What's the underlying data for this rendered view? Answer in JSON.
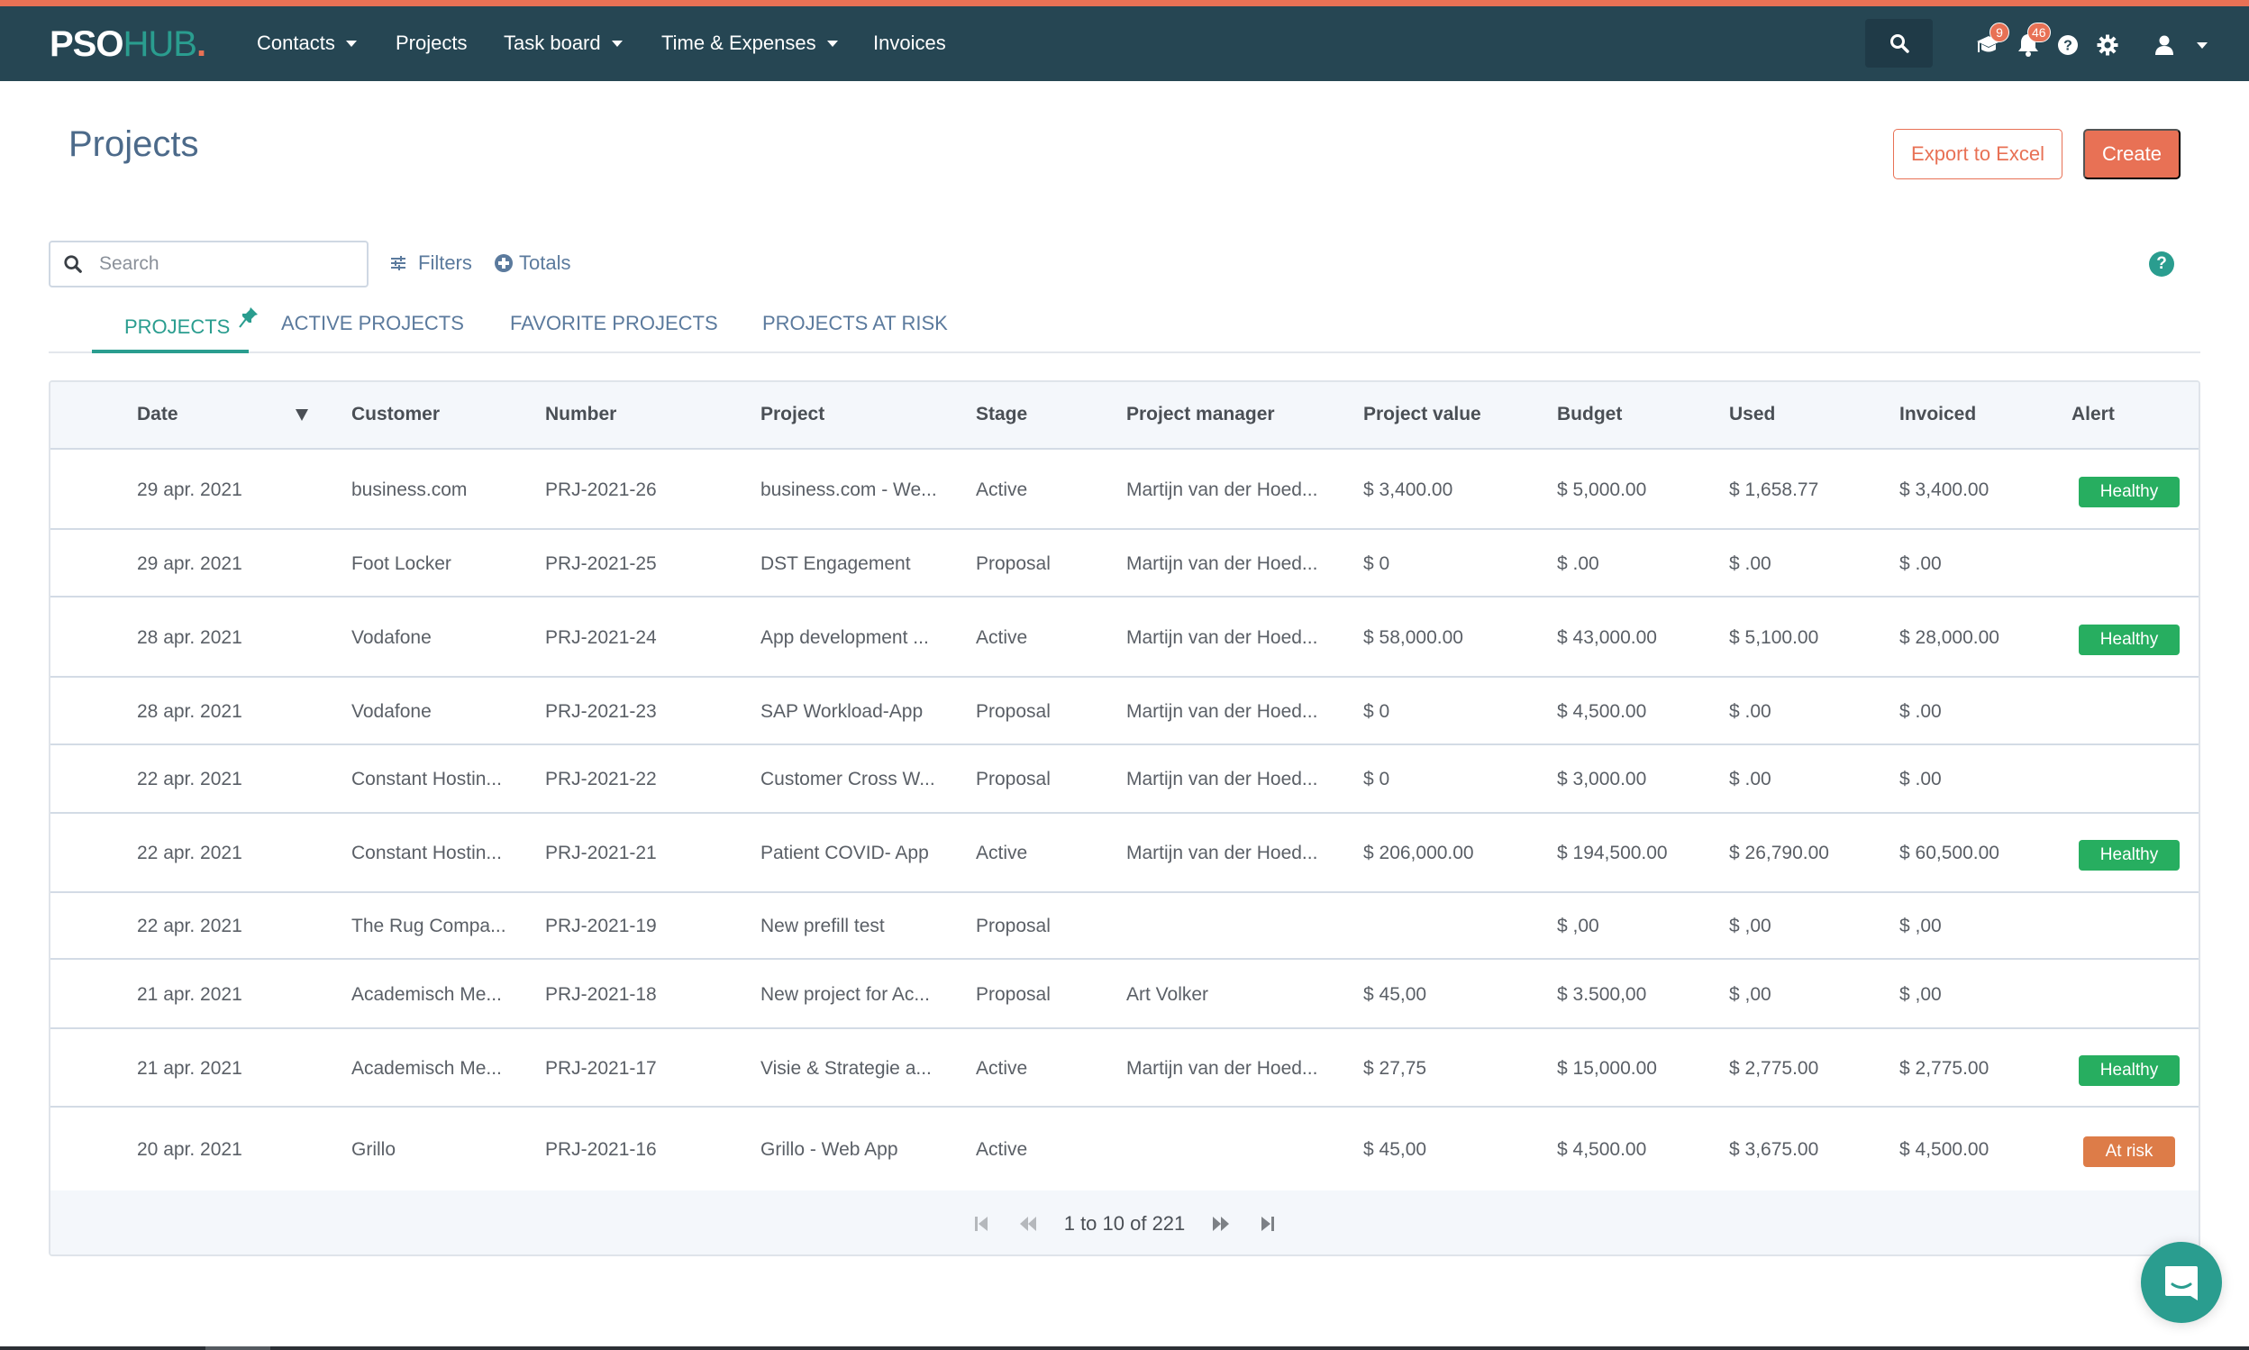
{
  "brand": {
    "part1": "PSO",
    "part2": "HUB",
    "part3": "."
  },
  "nav": {
    "items": [
      {
        "label": "Contacts",
        "dropdown": true
      },
      {
        "label": "Projects",
        "dropdown": false
      },
      {
        "label": "Task board",
        "dropdown": true
      },
      {
        "label": "Time & Expenses",
        "dropdown": true
      },
      {
        "label": "Invoices",
        "dropdown": false
      }
    ],
    "icons": {
      "search": "search-icon",
      "academy": "graduation-cap-icon",
      "notifications": "bell-icon",
      "help": "question-circle-icon",
      "settings": "gear-icon",
      "user": "user-icon"
    },
    "academy_badge": "9",
    "notifications_badge": "46"
  },
  "page": {
    "title": "Projects",
    "export_label": "Export to Excel",
    "create_label": "Create"
  },
  "toolbar": {
    "search_placeholder": "Search",
    "search_value": "",
    "filters_label": "Filters",
    "totals_label": "Totals",
    "help_label": "?"
  },
  "tabs": [
    {
      "label": "PROJECTS",
      "active": true,
      "pinned": true
    },
    {
      "label": "ACTIVE PROJECTS",
      "active": false
    },
    {
      "label": "FAVORITE PROJECTS",
      "active": false
    },
    {
      "label": "PROJECTS AT RISK",
      "active": false
    }
  ],
  "table": {
    "columns": [
      "Date",
      "Customer",
      "Number",
      "Project",
      "Stage",
      "Project manager",
      "Project value",
      "Budget",
      "Used",
      "Invoiced",
      "Alert"
    ],
    "sort": {
      "column": "Date",
      "direction": "descending"
    },
    "rows": [
      {
        "date": "29 apr. 2021",
        "customer": "business.com",
        "number": "PRJ-2021-26",
        "project": "business.com - We...",
        "stage": "Active",
        "manager": "Martijn van der Hoed...",
        "value": "$ 3,400.00",
        "budget": "$ 5,000.00",
        "used": "$ 1,658.77",
        "invoiced": "$ 3,400.00",
        "alert": "Healthy"
      },
      {
        "date": "29 apr. 2021",
        "customer": "Foot Locker",
        "number": "PRJ-2021-25",
        "project": "DST Engagement",
        "stage": "Proposal",
        "manager": "Martijn van der Hoed...",
        "value": "$ 0",
        "budget": "$ .00",
        "used": "$ .00",
        "invoiced": "$ .00",
        "alert": ""
      },
      {
        "date": "28 apr. 2021",
        "customer": "Vodafone",
        "number": "PRJ-2021-24",
        "project": "App development ...",
        "stage": "Active",
        "manager": "Martijn van der Hoed...",
        "value": "$ 58,000.00",
        "budget": "$ 43,000.00",
        "used": "$ 5,100.00",
        "invoiced": "$ 28,000.00",
        "alert": "Healthy"
      },
      {
        "date": "28 apr. 2021",
        "customer": "Vodafone",
        "number": "PRJ-2021-23",
        "project": "SAP Workload-App",
        "stage": "Proposal",
        "manager": "Martijn van der Hoed...",
        "value": "$ 0",
        "budget": "$ 4,500.00",
        "used": "$ .00",
        "invoiced": "$ .00",
        "alert": ""
      },
      {
        "date": "22 apr. 2021",
        "customer": "Constant Hostin...",
        "number": "PRJ-2021-22",
        "project": "Customer Cross W...",
        "stage": "Proposal",
        "manager": "Martijn van der Hoed...",
        "value": "$ 0",
        "budget": "$ 3,000.00",
        "used": "$ .00",
        "invoiced": "$ .00",
        "alert": ""
      },
      {
        "date": "22 apr. 2021",
        "customer": "Constant Hostin...",
        "number": "PRJ-2021-21",
        "project": "Patient COVID- App",
        "stage": "Active",
        "manager": "Martijn van der Hoed...",
        "value": "$ 206,000.00",
        "budget": "$ 194,500.00",
        "used": "$ 26,790.00",
        "invoiced": "$ 60,500.00",
        "alert": "Healthy"
      },
      {
        "date": "22 apr. 2021",
        "customer": "The Rug Compa...",
        "number": "PRJ-2021-19",
        "project": "New prefill test",
        "stage": "Proposal",
        "manager": "",
        "value": "",
        "budget": "$ ,00",
        "used": "$ ,00",
        "invoiced": "$ ,00",
        "alert": ""
      },
      {
        "date": "21 apr. 2021",
        "customer": "Academisch Me...",
        "number": "PRJ-2021-18",
        "project": "New project for Ac...",
        "stage": "Proposal",
        "manager": "Art Volker",
        "value": "$ 45,00",
        "budget": "$ 3.500,00",
        "used": "$ ,00",
        "invoiced": "$ ,00",
        "alert": ""
      },
      {
        "date": "21 apr. 2021",
        "customer": "Academisch Me...",
        "number": "PRJ-2021-17",
        "project": "Visie & Strategie a...",
        "stage": "Active",
        "manager": "Martijn van der Hoed...",
        "value": "$ 27,75",
        "budget": "$ 15,000.00",
        "used": "$ 2,775.00",
        "invoiced": "$ 2,775.00",
        "alert": "Healthy"
      },
      {
        "date": "20 apr. 2021",
        "customer": "Grillo",
        "number": "PRJ-2021-16",
        "project": "Grillo - Web App",
        "stage": "Active",
        "manager": "",
        "value": "$ 45,00",
        "budget": "$ 4,500.00",
        "used": "$ 3,675.00",
        "invoiced": "$ 4,500.00",
        "alert": "At risk"
      }
    ]
  },
  "pagination": {
    "text": "1 to 10 of 221"
  },
  "colors": {
    "brand_orange": "#e87155",
    "nav_bg": "#264653",
    "accent_teal": "#2a9d8f",
    "healthy": "#27ae60",
    "at_risk": "#dd7c48"
  }
}
